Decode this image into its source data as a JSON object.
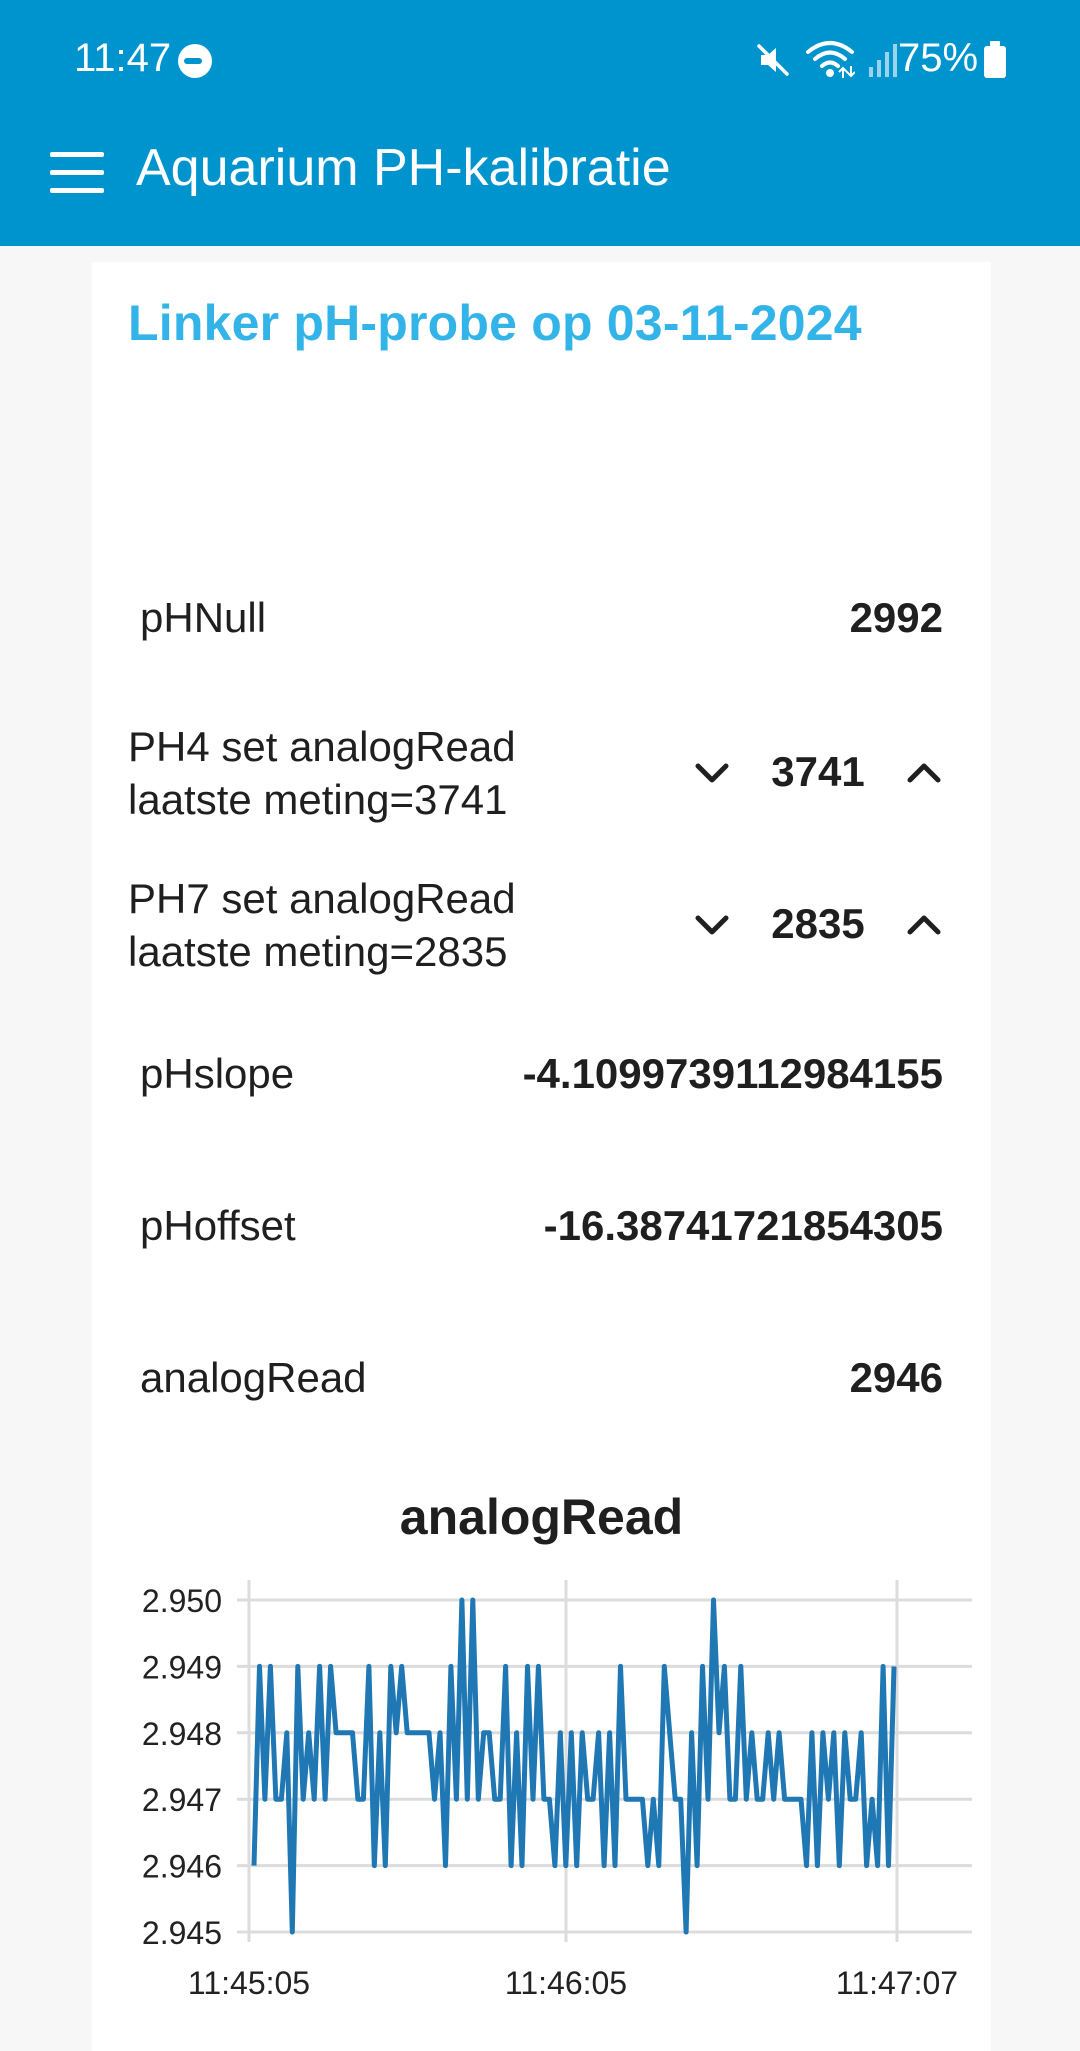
{
  "status_bar": {
    "time": "11:47",
    "battery": "75%",
    "icons": [
      "do-not-disturb-icon",
      "mute-icon",
      "wifi-icon",
      "signal-icon",
      "battery-icon"
    ]
  },
  "app_bar": {
    "title": "Aquarium PH-kalibratie",
    "menu_icon": "hamburger-menu-icon",
    "color": "#0094ce"
  },
  "card": {
    "title": "Linker pH-probe op 03-11-2024",
    "title_color": "#33b4e8",
    "rows": [
      {
        "label": "pHNull",
        "value": "2992"
      },
      {
        "label": "PH4 set analogRead",
        "sublabel": "laatste meting=3741",
        "value": "3741"
      },
      {
        "label": "PH7 set analogRead",
        "sublabel": "laatste meting=2835",
        "value": "2835"
      },
      {
        "label": "pHslope",
        "value": "-4.1099739112984155"
      },
      {
        "label": "pHoffset",
        "value": "-16.38741721854305"
      },
      {
        "label": "analogRead",
        "value": "2946"
      }
    ]
  },
  "chart_data": {
    "type": "line",
    "title": "analogRead",
    "xlabel": "",
    "ylabel": "",
    "x_tick_labels": [
      "11:45:05",
      "11:46:05",
      "11:47:07"
    ],
    "y_tick_labels": [
      "2.950",
      "2.949",
      "2.948",
      "2.947",
      "2.946",
      "2.945"
    ],
    "ylim": [
      2.945,
      2.95
    ],
    "grid": true,
    "line_color": "#1f77b4",
    "series": [
      {
        "values": [
          2.946,
          2.949,
          2.947,
          2.949,
          2.947,
          2.947,
          2.948,
          2.945,
          2.949,
          2.947,
          2.948,
          2.947,
          2.949,
          2.947,
          2.949,
          2.948,
          2.948,
          2.948,
          2.948,
          2.947,
          2.947,
          2.949,
          2.946,
          2.948,
          2.946,
          2.949,
          2.948,
          2.949,
          2.948,
          2.948,
          2.948,
          2.948,
          2.948,
          2.947,
          2.948,
          2.946,
          2.949,
          2.947,
          2.95,
          2.947,
          2.95,
          2.947,
          2.948,
          2.948,
          2.947,
          2.947,
          2.949,
          2.946,
          2.948,
          2.946,
          2.949,
          2.947,
          2.949,
          2.947,
          2.947,
          2.946,
          2.948,
          2.946,
          2.948,
          2.946,
          2.948,
          2.947,
          2.947,
          2.948,
          2.946,
          2.948,
          2.946,
          2.949,
          2.947,
          2.947,
          2.947,
          2.947,
          2.946,
          2.947,
          2.946,
          2.949,
          2.948,
          2.947,
          2.947,
          2.945,
          2.948,
          2.946,
          2.949,
          2.947,
          2.95,
          2.948,
          2.949,
          2.947,
          2.947,
          2.949,
          2.947,
          2.948,
          2.947,
          2.947,
          2.948,
          2.947,
          2.948,
          2.947,
          2.947,
          2.947,
          2.947,
          2.946,
          2.948,
          2.946,
          2.948,
          2.947,
          2.948,
          2.946,
          2.948,
          2.947,
          2.947,
          2.948,
          2.946,
          2.947,
          2.946,
          2.949,
          2.946,
          2.949
        ]
      }
    ]
  }
}
